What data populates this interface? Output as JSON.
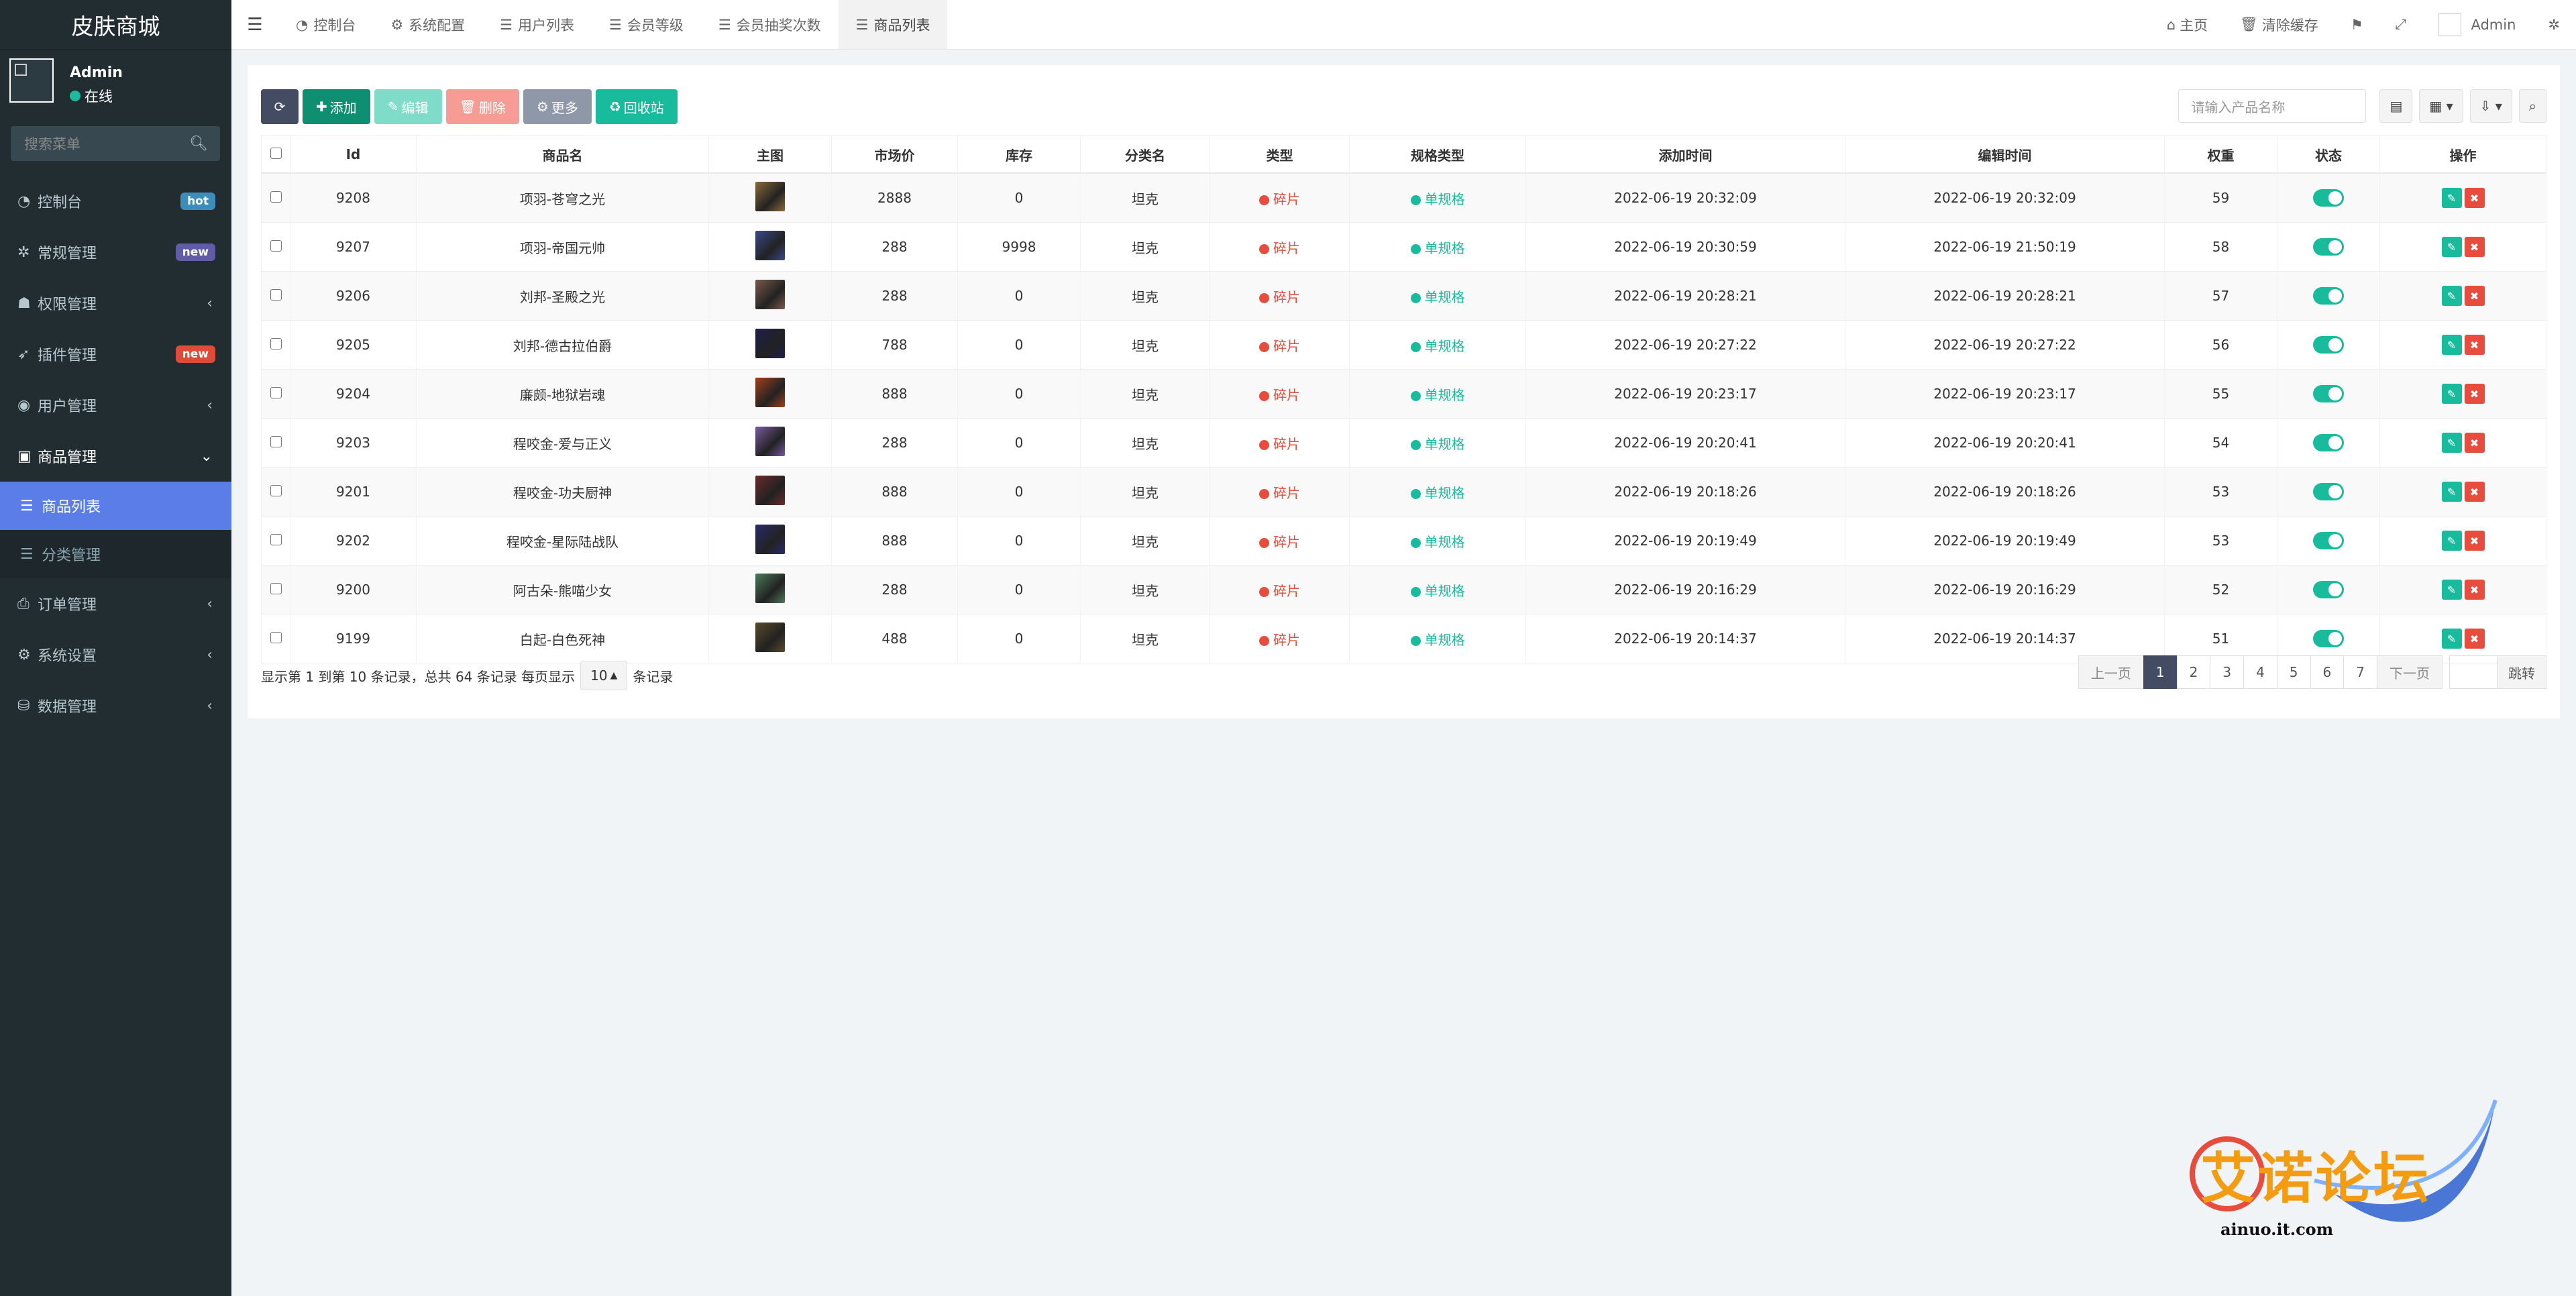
{
  "app": {
    "brand": "皮肤商城"
  },
  "user": {
    "name": "Admin",
    "status": "在线"
  },
  "sidebar": {
    "search_placeholder": "搜索菜单",
    "items": [
      {
        "label": "控制台",
        "icon": "dashboard-icon",
        "badge": "hot",
        "badge_color": "#3c8dbc"
      },
      {
        "label": "常规管理",
        "icon": "cogs-icon",
        "badge": "new",
        "badge_color": "#605ca8"
      },
      {
        "label": "权限管理",
        "icon": "group-icon",
        "caret": "‹"
      },
      {
        "label": "插件管理",
        "icon": "rocket-icon",
        "badge": "new",
        "badge_color": "#dd4b39"
      },
      {
        "label": "用户管理",
        "icon": "user-circle-icon",
        "caret": "‹"
      },
      {
        "label": "商品管理",
        "icon": "shopping-bag-icon",
        "caret": "⌄"
      },
      {
        "label": "订单管理",
        "icon": "print-icon",
        "caret": "‹"
      },
      {
        "label": "系统设置",
        "icon": "cog-icon",
        "caret": "‹"
      },
      {
        "label": "数据管理",
        "icon": "database-icon",
        "caret": "‹"
      }
    ],
    "sub_items": [
      {
        "label": "商品列表",
        "icon": "list-icon",
        "active": true
      },
      {
        "label": "分类管理",
        "icon": "list-icon",
        "active": false
      }
    ]
  },
  "topbar": {
    "tabs": [
      {
        "label": "控制台",
        "icon": "dashboard-icon"
      },
      {
        "label": "系统配置",
        "icon": "cog-icon"
      },
      {
        "label": "用户列表",
        "icon": "list-icon"
      },
      {
        "label": "会员等级",
        "icon": "list-icon"
      },
      {
        "label": "会员抽奖次数",
        "icon": "list-icon"
      },
      {
        "label": "商品列表",
        "icon": "list-icon"
      }
    ],
    "home": "主页",
    "clear_cache": "清除缓存",
    "admin": "Admin"
  },
  "toolbar": {
    "add": "添加",
    "edit": "编辑",
    "delete": "删除",
    "more": "更多",
    "recycle": "回收站",
    "search_placeholder": "请输入产品名称"
  },
  "table": {
    "columns": [
      "Id",
      "商品名",
      "主图",
      "市场价",
      "库存",
      "分类名",
      "类型",
      "规格类型",
      "添加时间",
      "编辑时间",
      "权重",
      "状态",
      "操作"
    ],
    "rows": [
      {
        "id": "9208",
        "name": "项羽-苍穹之光",
        "price": "2888",
        "stock": "0",
        "category": "坦克",
        "type": "碎片",
        "spec": "单规格",
        "added": "2022-06-19 20:32:09",
        "edited": "2022-06-19 20:32:09",
        "weight": "59",
        "thumb": "#8a6a3a"
      },
      {
        "id": "9207",
        "name": "项羽-帝国元帅",
        "price": "288",
        "stock": "9998",
        "category": "坦克",
        "type": "碎片",
        "spec": "单规格",
        "added": "2022-06-19 20:30:59",
        "edited": "2022-06-19 21:50:19",
        "weight": "58",
        "thumb": "#3a4a8a"
      },
      {
        "id": "9206",
        "name": "刘邦-圣殿之光",
        "price": "288",
        "stock": "0",
        "category": "坦克",
        "type": "碎片",
        "spec": "单规格",
        "added": "2022-06-19 20:28:21",
        "edited": "2022-06-19 20:28:21",
        "weight": "57",
        "thumb": "#7a5a4a"
      },
      {
        "id": "9205",
        "name": "刘邦-德古拉伯爵",
        "price": "788",
        "stock": "0",
        "category": "坦克",
        "type": "碎片",
        "spec": "单规格",
        "added": "2022-06-19 20:27:22",
        "edited": "2022-06-19 20:27:22",
        "weight": "56",
        "thumb": "#1e1e4a"
      },
      {
        "id": "9204",
        "name": "廉颇-地狱岩魂",
        "price": "888",
        "stock": "0",
        "category": "坦克",
        "type": "碎片",
        "spec": "单规格",
        "added": "2022-06-19 20:23:17",
        "edited": "2022-06-19 20:23:17",
        "weight": "55",
        "thumb": "#a0401a"
      },
      {
        "id": "9203",
        "name": "程咬金-爱与正义",
        "price": "288",
        "stock": "0",
        "category": "坦克",
        "type": "碎片",
        "spec": "单规格",
        "added": "2022-06-19 20:20:41",
        "edited": "2022-06-19 20:20:41",
        "weight": "54",
        "thumb": "#7a5aa0"
      },
      {
        "id": "9201",
        "name": "程咬金-功夫厨神",
        "price": "888",
        "stock": "0",
        "category": "坦克",
        "type": "碎片",
        "spec": "单规格",
        "added": "2022-06-19 20:18:26",
        "edited": "2022-06-19 20:18:26",
        "weight": "53",
        "thumb": "#6a2a2a"
      },
      {
        "id": "9202",
        "name": "程咬金-星际陆战队",
        "price": "888",
        "stock": "0",
        "category": "坦克",
        "type": "碎片",
        "spec": "单规格",
        "added": "2022-06-19 20:19:49",
        "edited": "2022-06-19 20:19:49",
        "weight": "53",
        "thumb": "#2a2a6a"
      },
      {
        "id": "9200",
        "name": "阿古朵-熊喵少女",
        "price": "288",
        "stock": "0",
        "category": "坦克",
        "type": "碎片",
        "spec": "单规格",
        "added": "2022-06-19 20:16:29",
        "edited": "2022-06-19 20:16:29",
        "weight": "52",
        "thumb": "#4a7a5a"
      },
      {
        "id": "9199",
        "name": "白起-白色死神",
        "price": "488",
        "stock": "0",
        "category": "坦克",
        "type": "碎片",
        "spec": "单规格",
        "added": "2022-06-19 20:14:37",
        "edited": "2022-06-19 20:14:37",
        "weight": "51",
        "thumb": "#5a4a2a"
      }
    ]
  },
  "footer": {
    "info": "显示第 1 到第 10 条记录，总共 64 条记录 每页显示",
    "page_size": "10",
    "suffix": "条记录"
  },
  "pager": {
    "prev": "上一页",
    "pages": [
      "1",
      "2",
      "3",
      "4",
      "5",
      "6",
      "7"
    ],
    "next": "下一页",
    "jump": "跳转"
  },
  "watermark": {
    "text": "艾诺论坛",
    "sub": "ainuo.it.com"
  },
  "colors": {
    "accent": "#18bc9c",
    "danger": "#e74c3c",
    "sidebar": "#222d32",
    "active": "#5a7de8"
  }
}
